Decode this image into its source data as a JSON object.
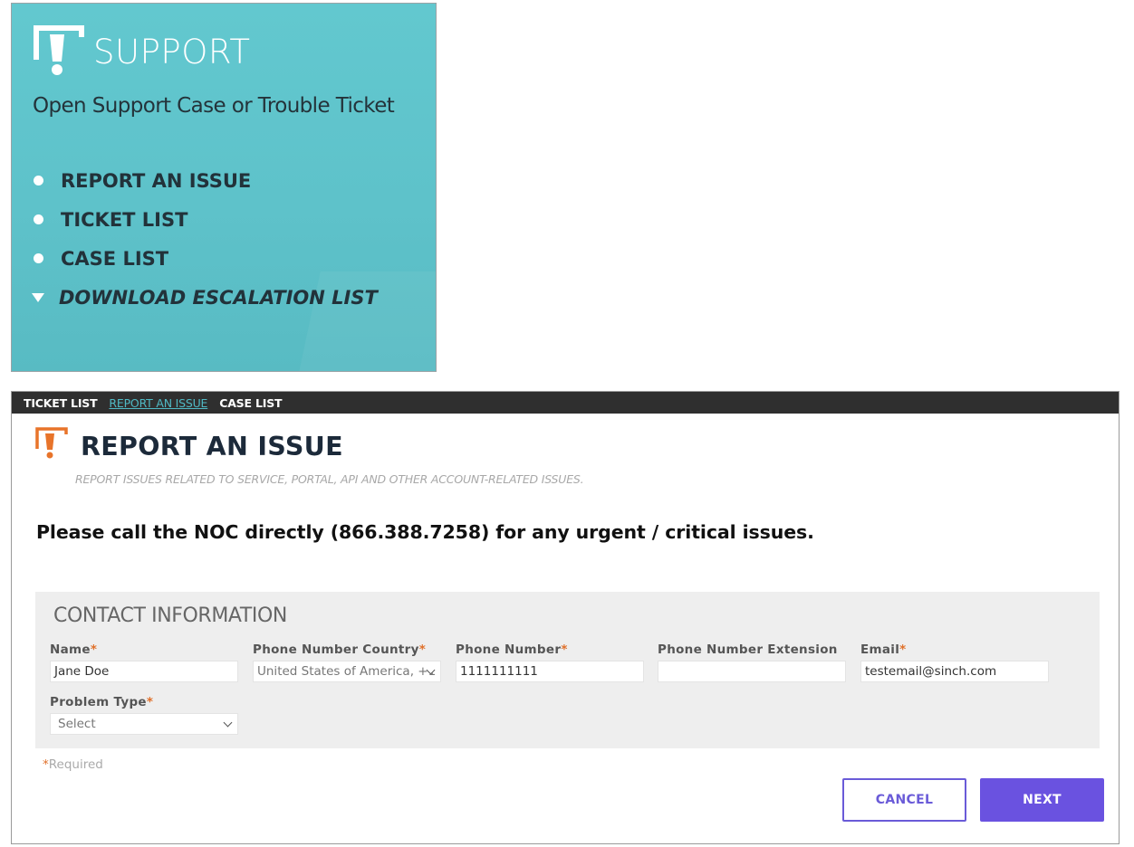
{
  "support": {
    "title": "SUPPORT",
    "subtitle": "Open Support Case or Trouble Ticket",
    "links": [
      {
        "label": "REPORT AN ISSUE"
      },
      {
        "label": "TICKET LIST"
      },
      {
        "label": "CASE LIST"
      },
      {
        "label": "DOWNLOAD ESCALATION LIST"
      }
    ]
  },
  "topnav": {
    "items": [
      {
        "label": "TICKET LIST"
      },
      {
        "label": "REPORT AN ISSUE",
        "active": true
      },
      {
        "label": "CASE LIST"
      }
    ]
  },
  "report": {
    "title": "REPORT AN ISSUE",
    "subtitle": "REPORT ISSUES RELATED TO SERVICE, PORTAL, API AND OTHER ACCOUNT-RELATED ISSUES.",
    "notice": "Please call the NOC directly (866.388.7258) for any urgent / critical issues."
  },
  "contact": {
    "title": "CONTACT INFORMATION",
    "name": {
      "label": "Name",
      "value": "Jane Doe"
    },
    "phone_country": {
      "label": "Phone Number Country",
      "value": "United States of America, +1"
    },
    "phone_number": {
      "label": "Phone Number",
      "value": "1111111111"
    },
    "phone_extension": {
      "label": "Phone Number Extension",
      "value": ""
    },
    "email": {
      "label": "Email",
      "value": "testemail@sinch.com"
    },
    "problem_type": {
      "label": "Problem Type",
      "value": "Select"
    },
    "required_mark": "*"
  },
  "required_note": {
    "mark": "*",
    "text": "Required"
  },
  "buttons": {
    "cancel": "CANCEL",
    "next": "NEXT"
  },
  "colors": {
    "support_bg": "#62c8cf",
    "logo_orange": "#e8742a",
    "accent_purple": "#6a52e0",
    "nav_bg": "#2f2f2f",
    "nav_active": "#4fb9c4"
  }
}
